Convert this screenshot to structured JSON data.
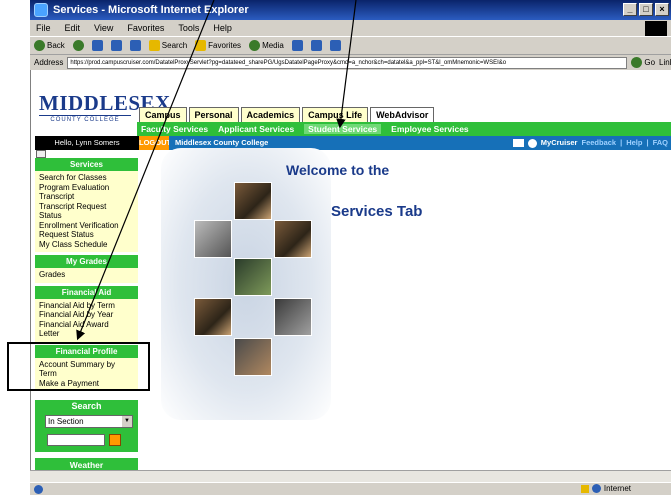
{
  "window": {
    "title": "Services - Microsoft Internet Explorer"
  },
  "menu": {
    "items": [
      "File",
      "Edit",
      "View",
      "Favorites",
      "Tools",
      "Help"
    ]
  },
  "toolbar": {
    "back": "Back",
    "search": "Search",
    "favorites": "Favorites",
    "media": "Media"
  },
  "address": {
    "label": "Address",
    "url": "https://prod.campuscruiser.com/DatatelProxyServlet?pg=datateed_sharePG/UgsDatatelPageProxy&cmd=a_nchor&ch=datatel&a_ppl=ST&l_omMnemonic=WSEI&o",
    "go": "Go",
    "links": "Links"
  },
  "site": {
    "logo_name": "MIDDLESEX",
    "logo_sub": "COUNTY COLLEGE",
    "tabs": [
      "Campus",
      "Personal",
      "Academics",
      "Campus Life",
      "WebAdvisor"
    ],
    "subnav": [
      "Faculty Services",
      "Applicant Services",
      "Student Services",
      "Employee Services"
    ],
    "hello": "Hello, Lynn Somers",
    "logout": "LOGOUT",
    "college": "Middlesex County College",
    "mycruiser": "MyCruiser",
    "feedback": "Feedback",
    "help": "Help",
    "faq": "FAQ"
  },
  "sidebar": {
    "services_title": "Services",
    "services_items": [
      "Search for Classes",
      "Program Evaluation",
      "Transcript",
      "Transcript Request",
      "Status",
      "Enrollment Verification",
      "Request Status",
      "My Class Schedule"
    ],
    "grades_title": "My Grades",
    "grades_items": [
      "Grades"
    ],
    "aid_title": "Financial Aid",
    "aid_items": [
      "Financial Aid by Term",
      "Financial Aid by Year",
      "Financial Aid Award",
      "Letter"
    ],
    "profile_title": "Financial Profile",
    "profile_items": [
      "Account Summary by",
      "Term",
      "Make a Payment"
    ],
    "search_title": "Search",
    "search_select": "In Section",
    "weather_title": "Weather"
  },
  "main": {
    "welcome": "Welcome to the",
    "services_tab": "Services Tab"
  },
  "status": {
    "zone": "Internet"
  }
}
